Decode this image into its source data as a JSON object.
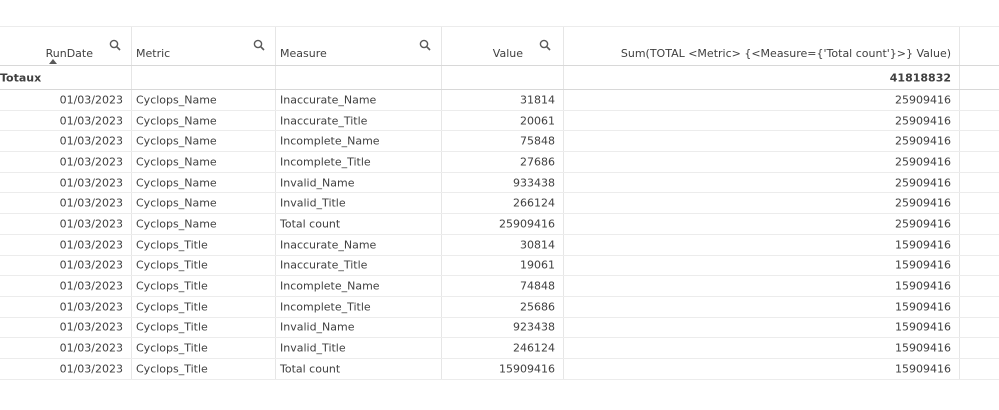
{
  "table": {
    "columns": [
      {
        "label": "RunDate"
      },
      {
        "label": "Metric"
      },
      {
        "label": "Measure"
      },
      {
        "label": "Value"
      },
      {
        "label": "Sum(TOTAL <Metric> {<Measure={'Total count'}>} Value)"
      }
    ],
    "totals": {
      "label": "Totaux",
      "sum": "41818832"
    },
    "rows": [
      [
        "01/03/2023",
        "Cyclops_Name",
        "Inaccurate_Name",
        "31814",
        "25909416"
      ],
      [
        "01/03/2023",
        "Cyclops_Name",
        "Inaccurate_Title",
        "20061",
        "25909416"
      ],
      [
        "01/03/2023",
        "Cyclops_Name",
        "Incomplete_Name",
        "75848",
        "25909416"
      ],
      [
        "01/03/2023",
        "Cyclops_Name",
        "Incomplete_Title",
        "27686",
        "25909416"
      ],
      [
        "01/03/2023",
        "Cyclops_Name",
        "Invalid_Name",
        "933438",
        "25909416"
      ],
      [
        "01/03/2023",
        "Cyclops_Name",
        "Invalid_Title",
        "266124",
        "25909416"
      ],
      [
        "01/03/2023",
        "Cyclops_Name",
        "Total count",
        "25909416",
        "25909416"
      ],
      [
        "01/03/2023",
        "Cyclops_Title",
        "Inaccurate_Name",
        "30814",
        "15909416"
      ],
      [
        "01/03/2023",
        "Cyclops_Title",
        "Inaccurate_Title",
        "19061",
        "15909416"
      ],
      [
        "01/03/2023",
        "Cyclops_Title",
        "Incomplete_Name",
        "74848",
        "15909416"
      ],
      [
        "01/03/2023",
        "Cyclops_Title",
        "Incomplete_Title",
        "25686",
        "15909416"
      ],
      [
        "01/03/2023",
        "Cyclops_Title",
        "Invalid_Name",
        "923438",
        "15909416"
      ],
      [
        "01/03/2023",
        "Cyclops_Title",
        "Invalid_Title",
        "246124",
        "15909416"
      ],
      [
        "01/03/2023",
        "Cyclops_Title",
        "Total count",
        "15909416",
        "15909416"
      ]
    ]
  },
  "icons": {
    "search": "search-icon",
    "sort": "sort-ascending-icon"
  },
  "colors": {
    "text": "#404040",
    "grid": "#ececec",
    "icon": "#595959"
  }
}
